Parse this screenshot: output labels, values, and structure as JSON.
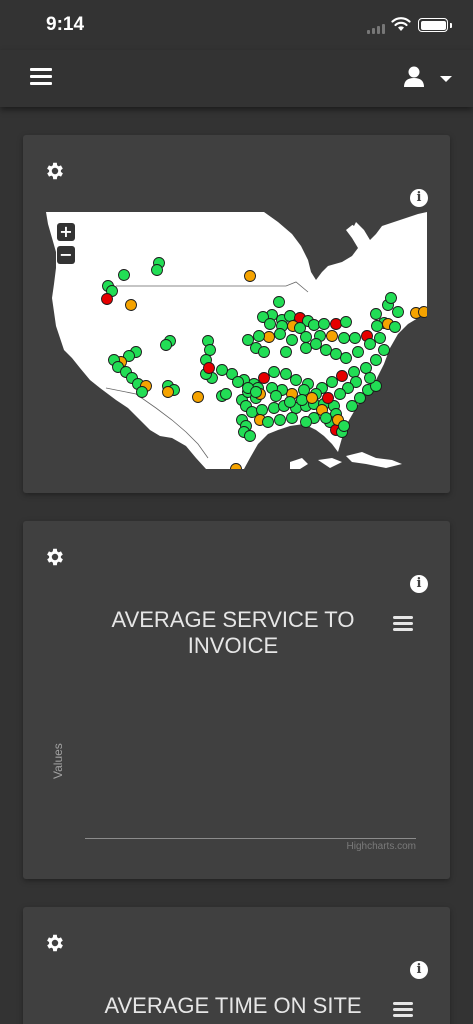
{
  "status_bar": {
    "time": "9:14"
  },
  "header": {
    "menu_icon": "hamburger-icon",
    "user_icon": "user-icon"
  },
  "cards": {
    "map": {
      "settings_icon": "gear-icon",
      "info_label": "i",
      "zoom_in_label": "+",
      "zoom_out_label": "−",
      "marker_colors": {
        "green": "#22dd55",
        "orange": "#f5a300",
        "red": "#e60000"
      }
    },
    "service_to_invoice": {
      "settings_icon": "gear-icon",
      "info_label": "i",
      "title_line1": "AVERAGE SERVICE TO",
      "title_line2": "INVOICE",
      "y_axis_label": "Values",
      "credits": "Highcharts.com"
    },
    "time_on_site": {
      "settings_icon": "gear-icon",
      "info_label": "i",
      "title": "AVERAGE TIME ON SITE"
    }
  }
}
